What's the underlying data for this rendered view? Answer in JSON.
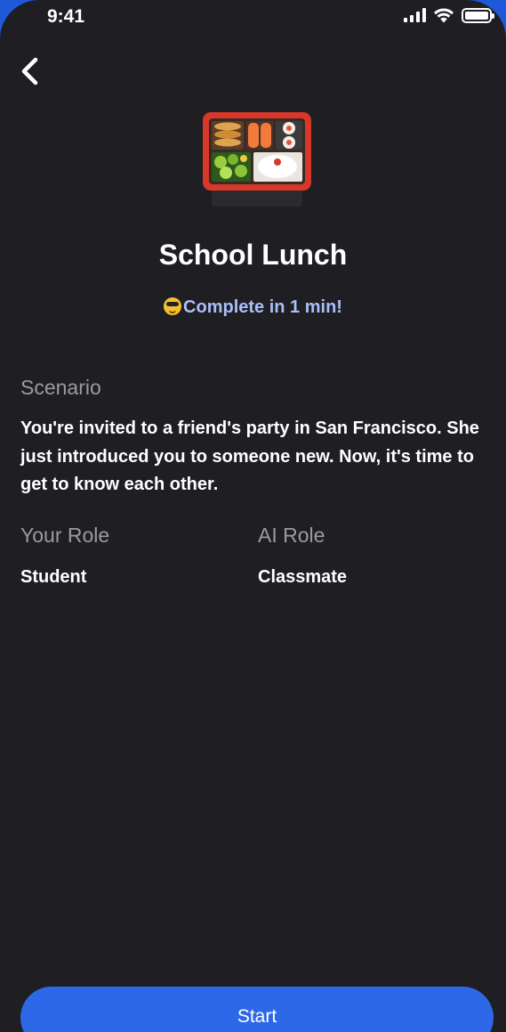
{
  "status_bar": {
    "time": "9:41",
    "icons": [
      "signal-icon",
      "wifi-icon",
      "battery-icon"
    ]
  },
  "nav": {
    "back_icon": "chevron-left-icon"
  },
  "lesson": {
    "icon": "bento-box-icon",
    "title": "School Lunch",
    "duration_emoji": "smiling-face-with-sunglasses-icon",
    "duration": "Complete in 1 min!"
  },
  "scenario": {
    "label": "Scenario",
    "text": "You're invited to a friend's party in San Francisco. She just introduced you to someone new. Now, it's time to get to know each other."
  },
  "roles": {
    "your_role_label": "Your Role",
    "your_role": "Student",
    "ai_role_label": "AI Role",
    "ai_role": "Classmate"
  },
  "actions": {
    "start_label": "Start"
  },
  "colors": {
    "background": "#1f1e22",
    "accent": "#2c68e8",
    "duration_text": "#a9bff8",
    "muted_label": "#9a9aa0"
  }
}
